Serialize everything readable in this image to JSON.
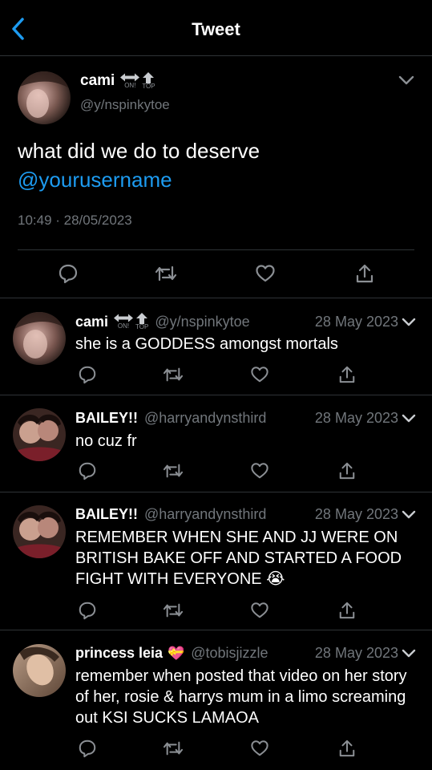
{
  "header": {
    "title": "Tweet"
  },
  "colors": {
    "background": "#000000",
    "accent": "#1d9bf0",
    "secondary_text": "#71767b",
    "divider": "#2f3336"
  },
  "main_tweet": {
    "name": "cami",
    "badges": [
      "ON!",
      "TOP"
    ],
    "handle": "@y/nspinkytoe",
    "text": "what did we do to deserve",
    "mention": "@yourusername",
    "timestamp": "10:49 · 28/05/2023"
  },
  "replies": [
    {
      "name": "cami",
      "badges": [
        "ON!",
        "TOP"
      ],
      "handle": "@y/nspinkytoe",
      "date": "28 May 2023",
      "text": "she is a GODDESS amongst mortals"
    },
    {
      "name": "BAILEY!!",
      "handle": "@harryandynsthird",
      "date": "28 May 2023",
      "text": "no cuz fr"
    },
    {
      "name": "BAILEY!!",
      "handle": "@harryandynsthird",
      "date": "28 May 2023",
      "text": "REMEMBER WHEN SHE AND JJ WERE ON BRITISH BAKE OFF AND STARTED A FOOD FIGHT WITH EVERYONE 😭"
    },
    {
      "name": "princess leia",
      "name_emoji": "💝",
      "handle": "@tobisjizzle",
      "date": "28 May 2023",
      "text": "remember when posted that video on her story of her, rosie & harrys mum in a limo screaming out KSI SUCKS LAMAOA"
    }
  ],
  "icons": [
    "back-chevron-icon",
    "chevron-down-icon",
    "reply-icon",
    "retweet-icon",
    "like-icon",
    "share-icon",
    "arrows-badge-icon",
    "up-arrow-badge-icon"
  ]
}
